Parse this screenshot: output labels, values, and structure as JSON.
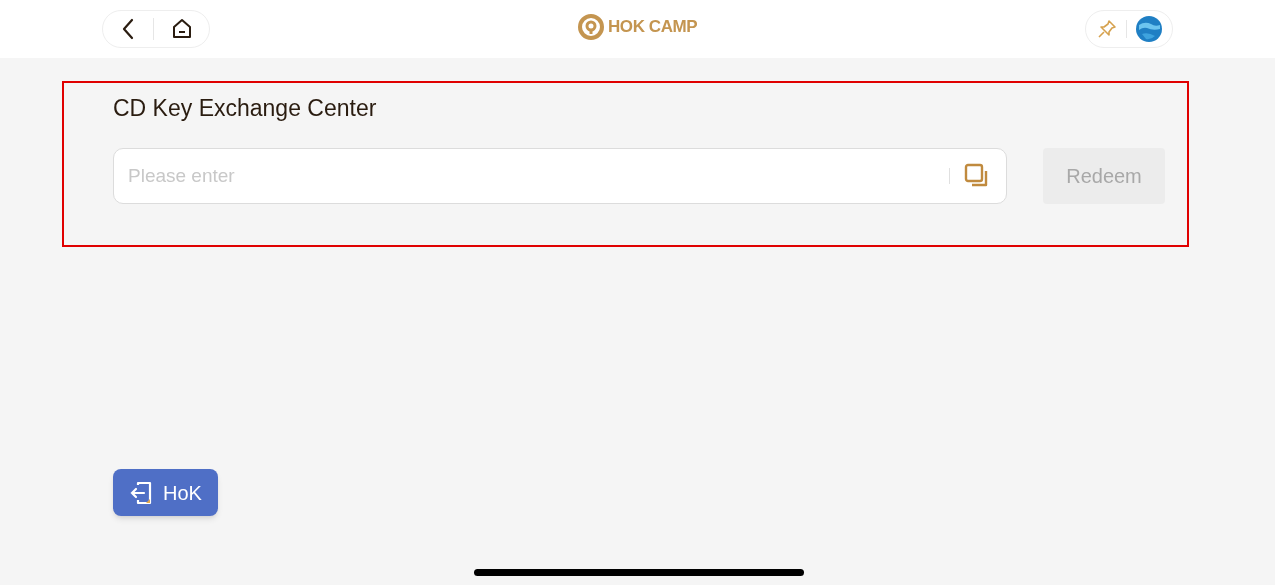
{
  "header": {
    "logo_text": "HOK CAMP"
  },
  "exchange": {
    "title": "CD Key Exchange Center",
    "input": {
      "placeholder": "Please enter"
    },
    "redeem_button": {
      "label": "Redeem",
      "disabled": true
    }
  },
  "floating_button": {
    "label": "HoK"
  }
}
